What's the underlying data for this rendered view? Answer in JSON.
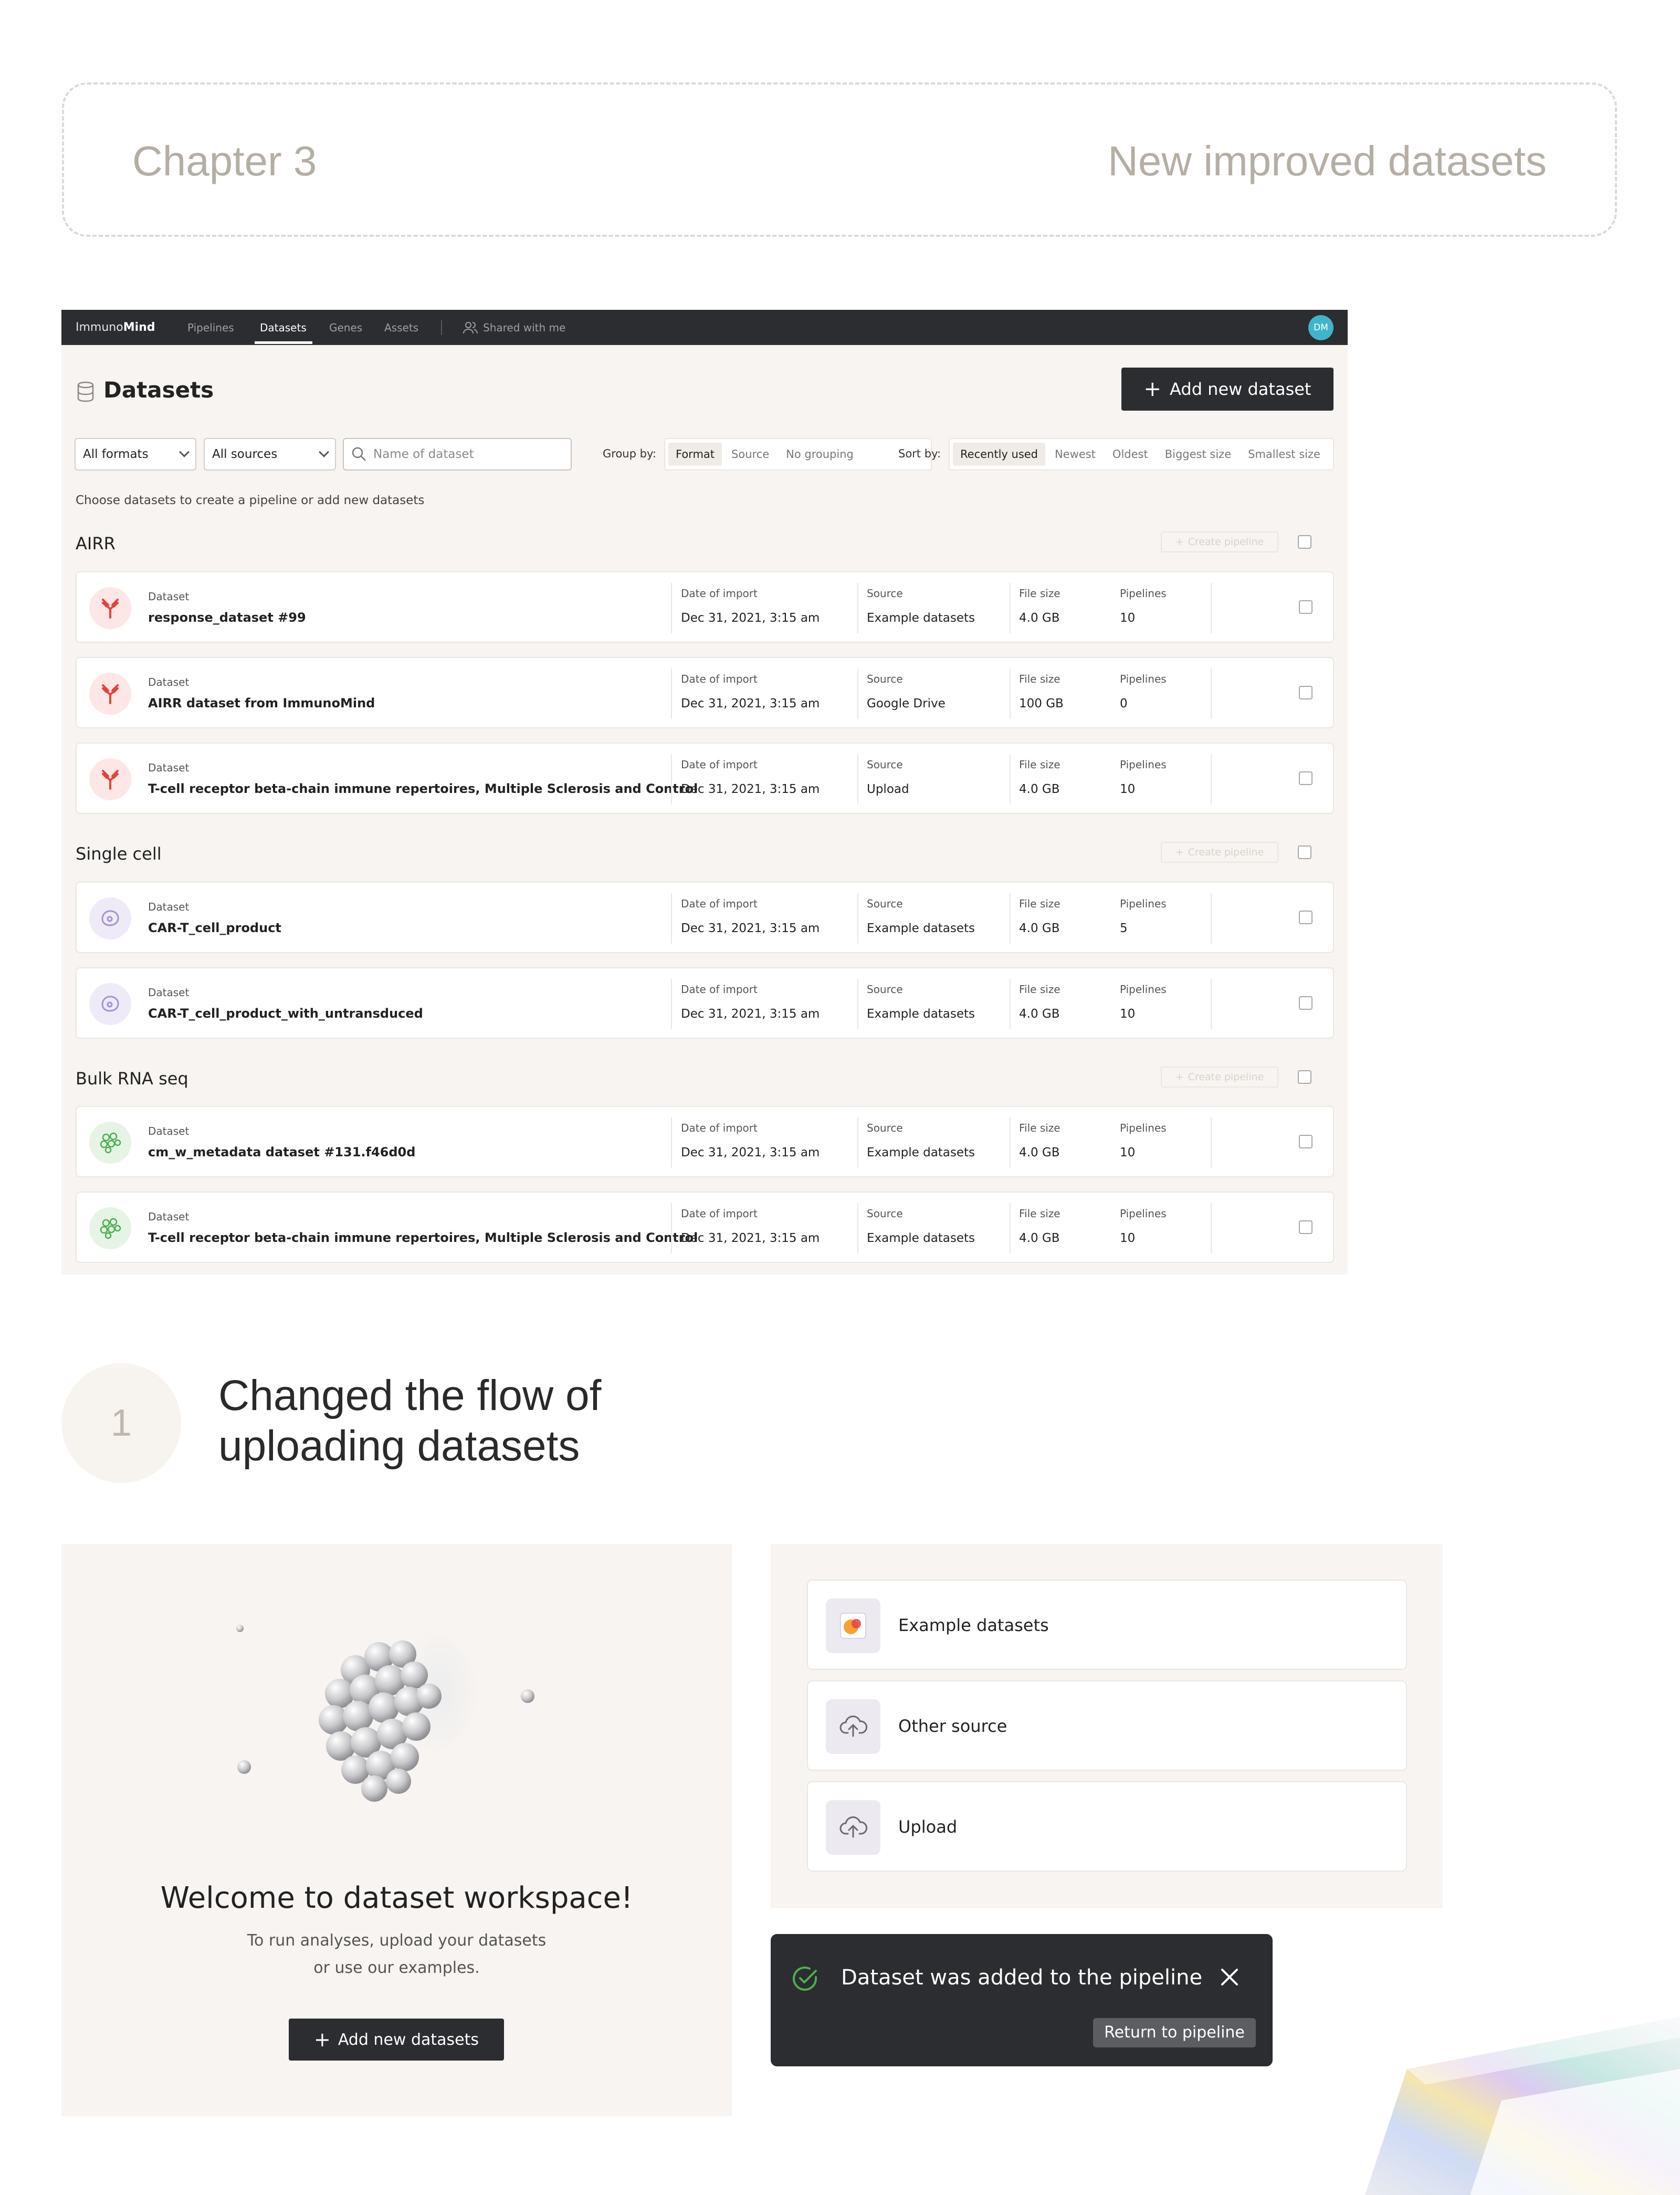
{
  "chapter": {
    "number": "Chapter 3",
    "title": "New improved datasets"
  },
  "app": {
    "logo_prefix": "Immuno",
    "logo_suffix": "Mind",
    "nav": [
      "Pipelines",
      "Datasets",
      "Genes",
      "Assets"
    ],
    "nav_shared": "Shared with me",
    "avatar": "DM",
    "page_title": "Datasets",
    "add_button": "Add new dataset",
    "filters": {
      "formats": "All formats",
      "sources": "All sources",
      "search_placeholder": "Name of dataset"
    },
    "group_by": {
      "label": "Group by:",
      "options": [
        "Format",
        "Source",
        "No grouping"
      ],
      "selected": "Format"
    },
    "sort_by": {
      "label": "Sort by:",
      "options": [
        "Recently used",
        "Newest",
        "Oldest",
        "Biggest size",
        "Smallest size"
      ],
      "selected": "Recently used"
    },
    "hint": "Choose datasets to create a pipeline or add new datasets",
    "create_pipeline": "Create pipeline",
    "labels": {
      "dataset": "Dataset",
      "date": "Date of import",
      "source": "Source",
      "size": "File size",
      "pipelines": "Pipelines"
    },
    "groups": [
      {
        "title": "AIRR",
        "rows": [
          {
            "name": "response_dataset #99",
            "date": "Dec 31, 2021, 3:15 am",
            "source": "Example datasets",
            "size": "4.0 GB",
            "pipelines": "10"
          },
          {
            "name": "AIRR dataset from ImmunoMind",
            "date": "Dec 31, 2021, 3:15 am",
            "source": "Google Drive",
            "size": "100 GB",
            "pipelines": "0"
          },
          {
            "name": "T-cell receptor beta-chain immune repertoires, Multiple Sclerosis and Control",
            "date": "Dec 31, 2021, 3:15 am",
            "source": "Upload",
            "size": "4.0 GB",
            "pipelines": "10"
          }
        ]
      },
      {
        "title": "Single cell",
        "rows": [
          {
            "name": "CAR-T_cell_product",
            "date": "Dec 31, 2021, 3:15 am",
            "source": "Example datasets",
            "size": "4.0 GB",
            "pipelines": "5"
          },
          {
            "name": "CAR-T_cell_product_with_untransduced",
            "date": "Dec 31, 2021, 3:15 am",
            "source": "Example datasets",
            "size": "4.0 GB",
            "pipelines": "10"
          }
        ]
      },
      {
        "title": "Bulk RNA seq",
        "rows": [
          {
            "name": "cm_w_metadata dataset #131.f46d0d",
            "date": "Dec 31, 2021, 3:15 am",
            "source": "Example datasets",
            "size": "4.0 GB",
            "pipelines": "10"
          },
          {
            "name": "T-cell receptor beta-chain immune repertoires, Multiple Sclerosis and Control",
            "date": "Dec 31, 2021, 3:15 am",
            "source": "Example datasets",
            "size": "4.0 GB",
            "pipelines": "10"
          }
        ]
      }
    ],
    "icons": {
      "airr": "antibody-icon",
      "single_cell": "cell-icon",
      "bulk": "cells-cluster-icon"
    },
    "colors": {
      "airr": "#e5423b",
      "single_cell": "#a493d3",
      "bulk": "#4caf50",
      "dark": "#2b2d30",
      "avatar": "#3fb5c9"
    }
  },
  "section1": {
    "number": "1",
    "title_line1": "Changed the flow of",
    "title_line2": "uploading datasets"
  },
  "welcome": {
    "title": "Welcome to dataset workspace!",
    "text_line1": "To run analyses, upload your datasets",
    "text_line2": "or use our examples.",
    "button": "Add new datasets"
  },
  "sources": [
    "Example datasets",
    "Other source",
    "Upload"
  ],
  "toast": {
    "message": "Dataset was added to the pipeline",
    "action": "Return to pipeline"
  }
}
